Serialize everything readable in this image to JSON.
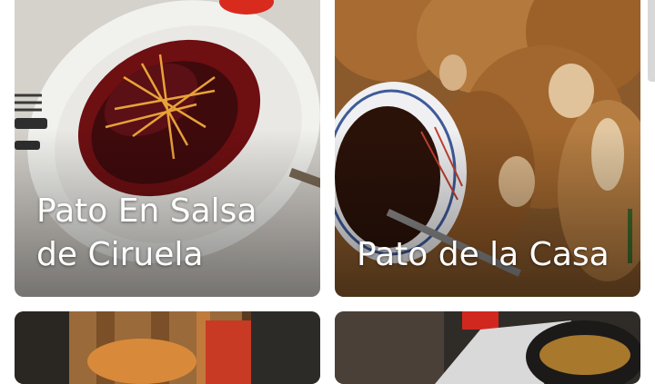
{
  "cards": [
    {
      "title": "Pato En Salsa de Ciruela",
      "photo": "duck-plum-sauce-photo"
    },
    {
      "title": "Pato de la Casa",
      "photo": "house-duck-photo"
    },
    {
      "title": "",
      "photo": "restaurant-interior-photo"
    },
    {
      "title": "",
      "photo": "spice-bowl-photo"
    }
  ]
}
